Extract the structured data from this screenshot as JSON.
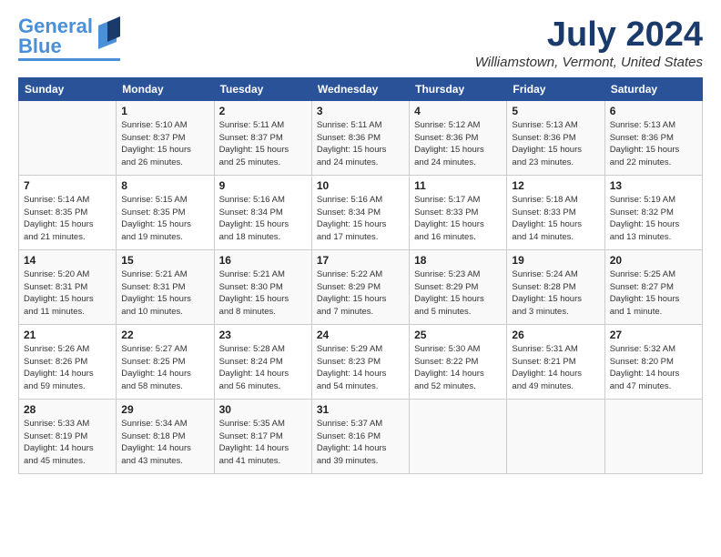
{
  "header": {
    "logo_line1": "General",
    "logo_line2": "Blue",
    "month": "July 2024",
    "location": "Williamstown, Vermont, United States"
  },
  "weekdays": [
    "Sunday",
    "Monday",
    "Tuesday",
    "Wednesday",
    "Thursday",
    "Friday",
    "Saturday"
  ],
  "weeks": [
    [
      {
        "num": "",
        "info": ""
      },
      {
        "num": "1",
        "info": "Sunrise: 5:10 AM\nSunset: 8:37 PM\nDaylight: 15 hours\nand 26 minutes."
      },
      {
        "num": "2",
        "info": "Sunrise: 5:11 AM\nSunset: 8:37 PM\nDaylight: 15 hours\nand 25 minutes."
      },
      {
        "num": "3",
        "info": "Sunrise: 5:11 AM\nSunset: 8:36 PM\nDaylight: 15 hours\nand 24 minutes."
      },
      {
        "num": "4",
        "info": "Sunrise: 5:12 AM\nSunset: 8:36 PM\nDaylight: 15 hours\nand 24 minutes."
      },
      {
        "num": "5",
        "info": "Sunrise: 5:13 AM\nSunset: 8:36 PM\nDaylight: 15 hours\nand 23 minutes."
      },
      {
        "num": "6",
        "info": "Sunrise: 5:13 AM\nSunset: 8:36 PM\nDaylight: 15 hours\nand 22 minutes."
      }
    ],
    [
      {
        "num": "7",
        "info": "Sunrise: 5:14 AM\nSunset: 8:35 PM\nDaylight: 15 hours\nand 21 minutes."
      },
      {
        "num": "8",
        "info": "Sunrise: 5:15 AM\nSunset: 8:35 PM\nDaylight: 15 hours\nand 19 minutes."
      },
      {
        "num": "9",
        "info": "Sunrise: 5:16 AM\nSunset: 8:34 PM\nDaylight: 15 hours\nand 18 minutes."
      },
      {
        "num": "10",
        "info": "Sunrise: 5:16 AM\nSunset: 8:34 PM\nDaylight: 15 hours\nand 17 minutes."
      },
      {
        "num": "11",
        "info": "Sunrise: 5:17 AM\nSunset: 8:33 PM\nDaylight: 15 hours\nand 16 minutes."
      },
      {
        "num": "12",
        "info": "Sunrise: 5:18 AM\nSunset: 8:33 PM\nDaylight: 15 hours\nand 14 minutes."
      },
      {
        "num": "13",
        "info": "Sunrise: 5:19 AM\nSunset: 8:32 PM\nDaylight: 15 hours\nand 13 minutes."
      }
    ],
    [
      {
        "num": "14",
        "info": "Sunrise: 5:20 AM\nSunset: 8:31 PM\nDaylight: 15 hours\nand 11 minutes."
      },
      {
        "num": "15",
        "info": "Sunrise: 5:21 AM\nSunset: 8:31 PM\nDaylight: 15 hours\nand 10 minutes."
      },
      {
        "num": "16",
        "info": "Sunrise: 5:21 AM\nSunset: 8:30 PM\nDaylight: 15 hours\nand 8 minutes."
      },
      {
        "num": "17",
        "info": "Sunrise: 5:22 AM\nSunset: 8:29 PM\nDaylight: 15 hours\nand 7 minutes."
      },
      {
        "num": "18",
        "info": "Sunrise: 5:23 AM\nSunset: 8:29 PM\nDaylight: 15 hours\nand 5 minutes."
      },
      {
        "num": "19",
        "info": "Sunrise: 5:24 AM\nSunset: 8:28 PM\nDaylight: 15 hours\nand 3 minutes."
      },
      {
        "num": "20",
        "info": "Sunrise: 5:25 AM\nSunset: 8:27 PM\nDaylight: 15 hours\nand 1 minute."
      }
    ],
    [
      {
        "num": "21",
        "info": "Sunrise: 5:26 AM\nSunset: 8:26 PM\nDaylight: 14 hours\nand 59 minutes."
      },
      {
        "num": "22",
        "info": "Sunrise: 5:27 AM\nSunset: 8:25 PM\nDaylight: 14 hours\nand 58 minutes."
      },
      {
        "num": "23",
        "info": "Sunrise: 5:28 AM\nSunset: 8:24 PM\nDaylight: 14 hours\nand 56 minutes."
      },
      {
        "num": "24",
        "info": "Sunrise: 5:29 AM\nSunset: 8:23 PM\nDaylight: 14 hours\nand 54 minutes."
      },
      {
        "num": "25",
        "info": "Sunrise: 5:30 AM\nSunset: 8:22 PM\nDaylight: 14 hours\nand 52 minutes."
      },
      {
        "num": "26",
        "info": "Sunrise: 5:31 AM\nSunset: 8:21 PM\nDaylight: 14 hours\nand 49 minutes."
      },
      {
        "num": "27",
        "info": "Sunrise: 5:32 AM\nSunset: 8:20 PM\nDaylight: 14 hours\nand 47 minutes."
      }
    ],
    [
      {
        "num": "28",
        "info": "Sunrise: 5:33 AM\nSunset: 8:19 PM\nDaylight: 14 hours\nand 45 minutes."
      },
      {
        "num": "29",
        "info": "Sunrise: 5:34 AM\nSunset: 8:18 PM\nDaylight: 14 hours\nand 43 minutes."
      },
      {
        "num": "30",
        "info": "Sunrise: 5:35 AM\nSunset: 8:17 PM\nDaylight: 14 hours\nand 41 minutes."
      },
      {
        "num": "31",
        "info": "Sunrise: 5:37 AM\nSunset: 8:16 PM\nDaylight: 14 hours\nand 39 minutes."
      },
      {
        "num": "",
        "info": ""
      },
      {
        "num": "",
        "info": ""
      },
      {
        "num": "",
        "info": ""
      }
    ]
  ]
}
